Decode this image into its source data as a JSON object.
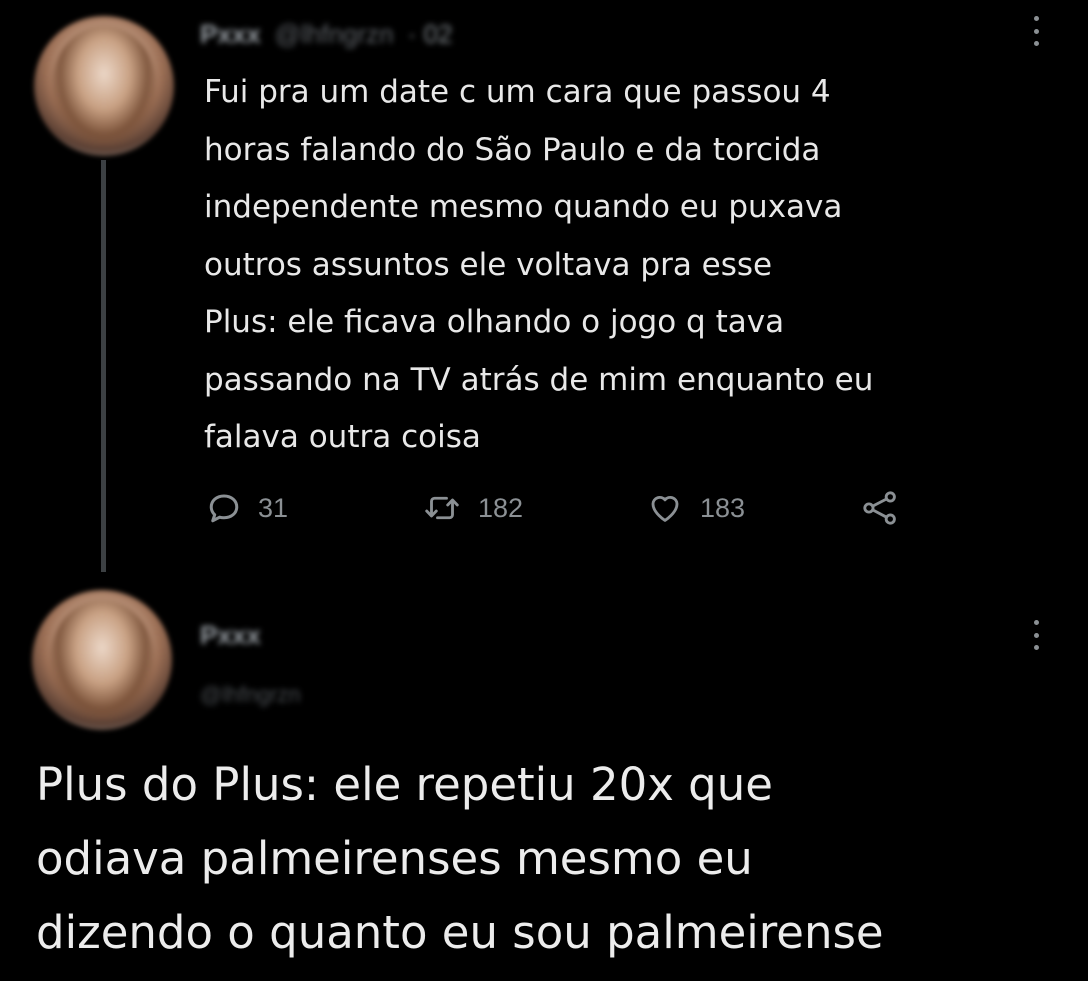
{
  "tweets": [
    {
      "author_name": "Pxxx",
      "author_handle": "@lhfngrzn",
      "time": "· 02",
      "text": "Fui pra um date c um cara que passou 4\nhoras falando do São Paulo e da torcida\nindependente mesmo quando eu puxava\noutros assuntos ele voltava pra esse\nPlus: ele ficava olhando o jogo q tava\npassando na TV atrás de mim enquanto eu\nfalava outra coisa",
      "replies": "31",
      "retweets": "182",
      "likes": "183",
      "icons": {
        "reply": "reply-icon",
        "retweet": "retweet-icon",
        "like": "heart-icon",
        "share": "share-icon",
        "more": "more-vertical-icon"
      }
    },
    {
      "author_name": "Pxxx",
      "author_handle": "@lhfngrzn",
      "text": "Plus do Plus: ele repetiu 20x que\nodiava palmeirenses mesmo eu\ndizendo o quanto eu sou palmeirense",
      "icons": {
        "more": "more-vertical-icon"
      }
    }
  ],
  "colors": {
    "background": "#000000",
    "text": "#e7e9ea",
    "muted": "#8b9094",
    "thread_line": "#3c4043"
  }
}
